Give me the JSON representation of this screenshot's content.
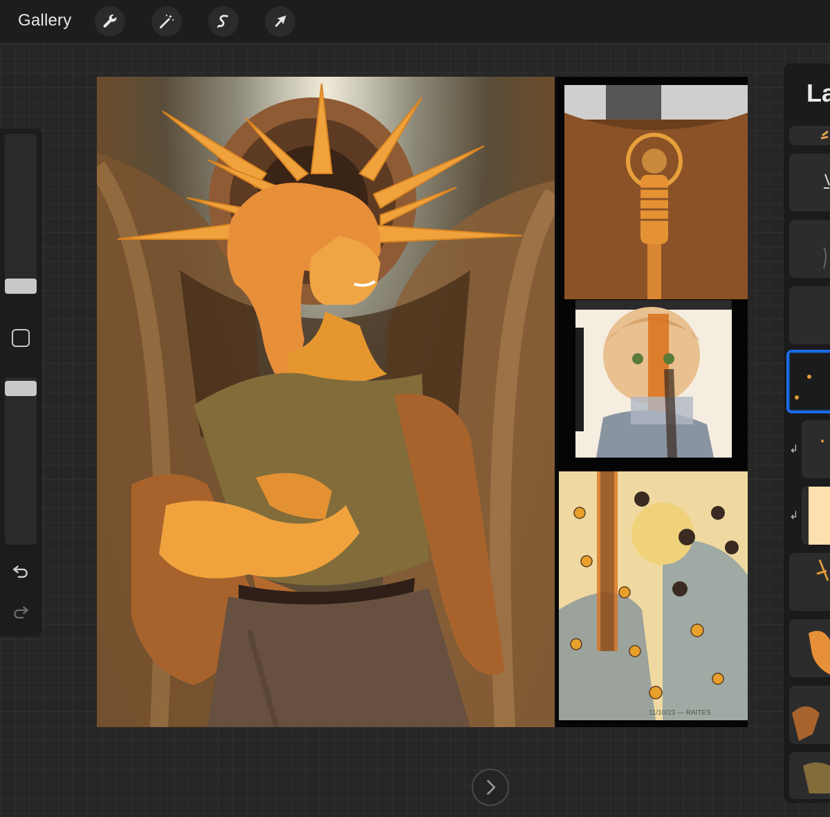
{
  "toolbar": {
    "gallery_label": "Gallery",
    "tools": [
      {
        "name": "actions",
        "icon": "wrench-icon"
      },
      {
        "name": "adjustments",
        "icon": "magic-wand-icon"
      },
      {
        "name": "selection",
        "icon": "selection-s-icon"
      },
      {
        "name": "transform",
        "icon": "arrow-cursor-icon"
      }
    ]
  },
  "side_panel": {
    "brush_size_level": 0.25,
    "opacity_level": 0.85,
    "icons": [
      "modify-square-icon",
      "undo-icon",
      "redo-icon"
    ]
  },
  "layers_panel": {
    "title": "La"
  },
  "colors": {
    "accent": "#1a6ff2",
    "toolbar_bg": "#1d1d1d",
    "canvas_bg": "#262626",
    "skin": "#e88f3a",
    "shirt": "#826c3a",
    "cloak": "#a8632c",
    "pants": "#67503f"
  },
  "artwork": {
    "signature": "11/10/23 — RAITES"
  }
}
